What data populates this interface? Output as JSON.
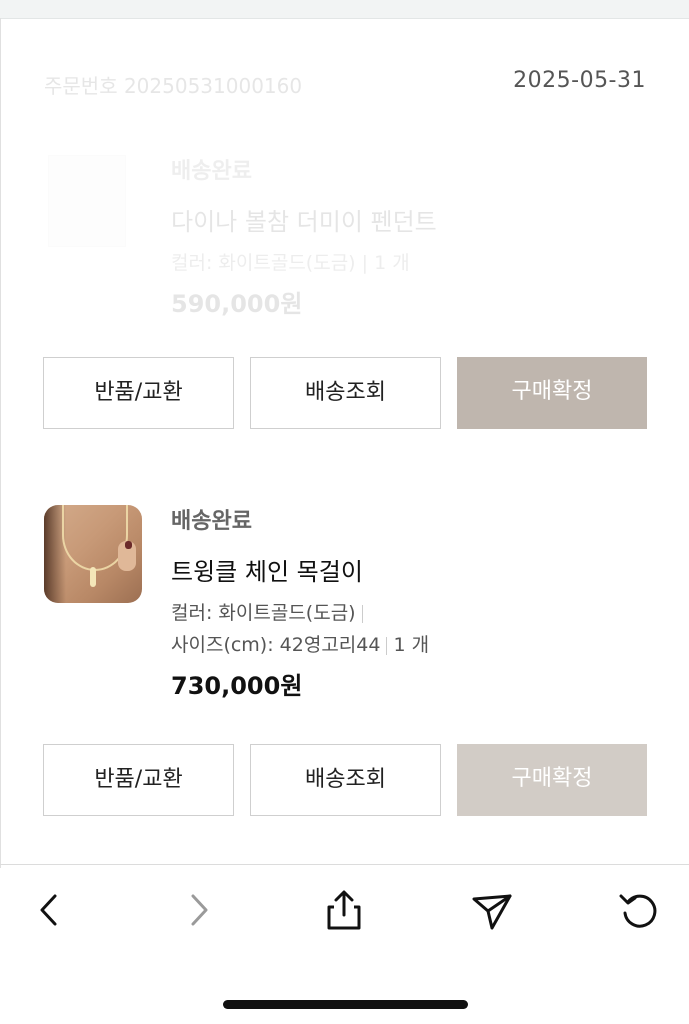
{
  "order": {
    "number": "주문번호 20250531000160",
    "date": "2025-05-31"
  },
  "items": [
    {
      "status": "배송완료",
      "name": "다이나 볼참 더미이 펜던트",
      "option": "컬러: 화이트골드(도금) | 1 개",
      "price": "590,000원"
    },
    {
      "status": "배송완료",
      "name": "트윙클 체인 목걸이",
      "option_color": "컬러: 화이트골드(도금)",
      "option_size": "사이즈(cm): 42영고리44",
      "quantity": "1 개",
      "price": "730,000원"
    }
  ],
  "buttons": {
    "return_exchange": "반품/교환",
    "track": "배송조회",
    "confirm": "구매확정"
  },
  "toolbar": {
    "back": "chevron-left-icon",
    "forward": "chevron-right-icon",
    "share": "share-icon",
    "send": "send-icon",
    "reload": "reload-icon"
  },
  "colors": {
    "confirm_button": "#bfb6ae",
    "confirm_button_light": "#d2ccc6"
  }
}
